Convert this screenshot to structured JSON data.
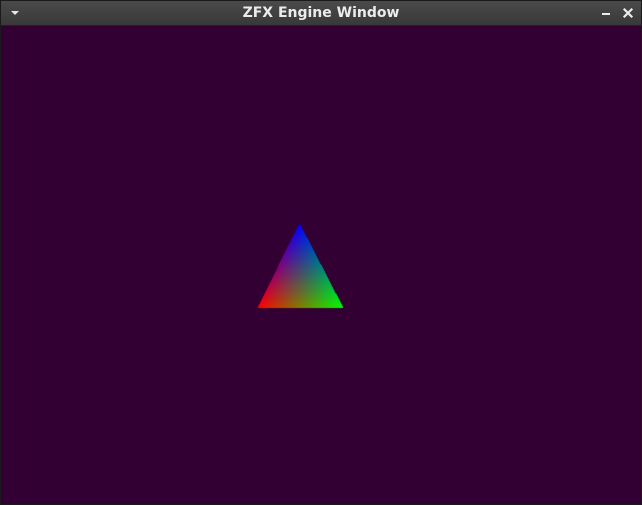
{
  "window": {
    "title": "ZFX Engine Window",
    "background_color": "#330033"
  },
  "titlebar": {
    "menu_icon": "chevron-down-icon",
    "minimize_icon": "minimize-icon",
    "close_icon": "close-icon"
  },
  "scene": {
    "shape": "triangle",
    "vertex_colors": {
      "top": "#0000ff",
      "bottom_left": "#ff0000",
      "bottom_right": "#00ff00"
    }
  }
}
